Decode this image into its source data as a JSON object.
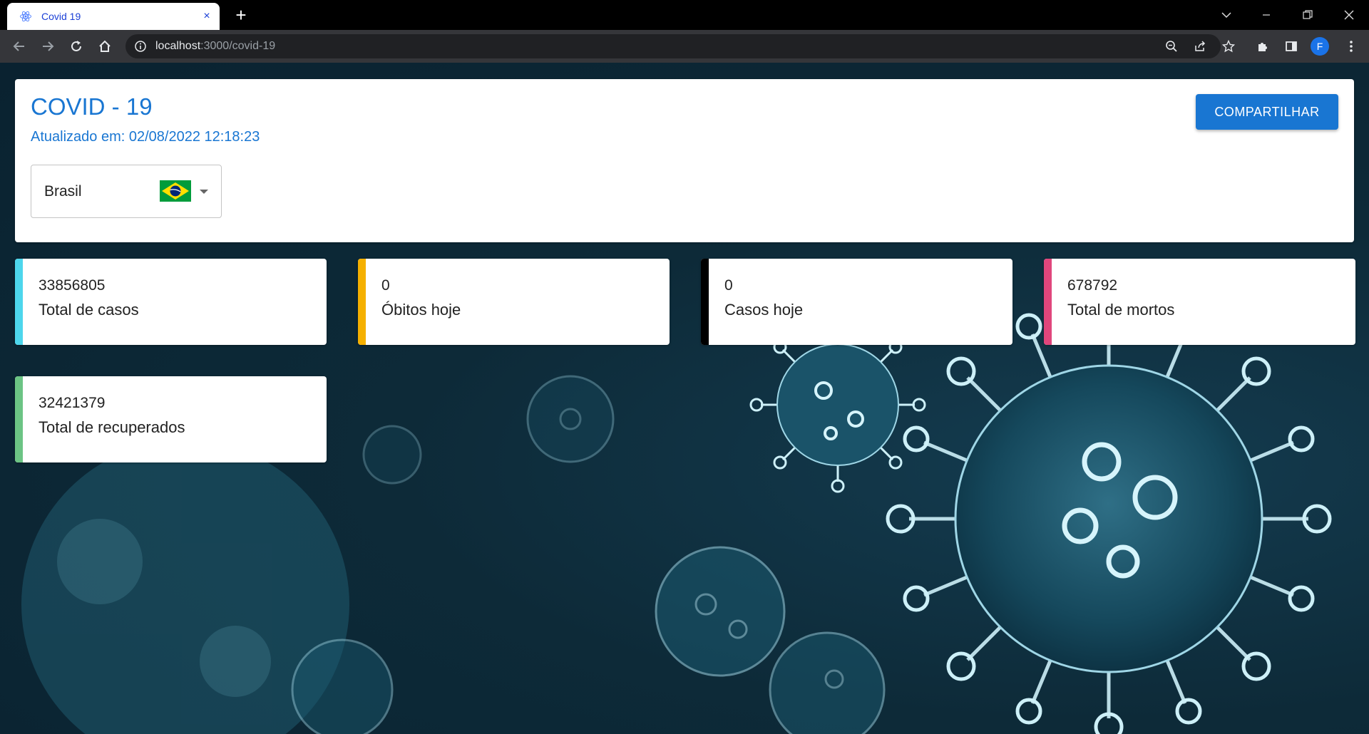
{
  "browser": {
    "tab_title": "Covid 19",
    "tab_close": "×",
    "new_tab": "+",
    "url_host": "localhost",
    "url_path": ":3000/covid-19",
    "profile_initial": "F"
  },
  "header": {
    "title": "COVID - 19",
    "updated": "Atualizado em: 02/08/2022 12:18:23",
    "share_label": "COMPARTILHAR",
    "country": "Brasil"
  },
  "stats": [
    {
      "value": "33856805",
      "label": "Total de casos",
      "color": "#4dd6ec"
    },
    {
      "value": "0",
      "label": "Óbitos hoje",
      "color": "#f5b000"
    },
    {
      "value": "0",
      "label": "Casos hoje",
      "color": "#000000"
    },
    {
      "value": "678792",
      "label": "Total de mortos",
      "color": "#e0467c"
    },
    {
      "value": "32421379",
      "label": "Total de recuperados",
      "color": "#6cc484"
    }
  ],
  "colors": {
    "accent": "#1976d2",
    "brand_flag": "#009c3b"
  }
}
